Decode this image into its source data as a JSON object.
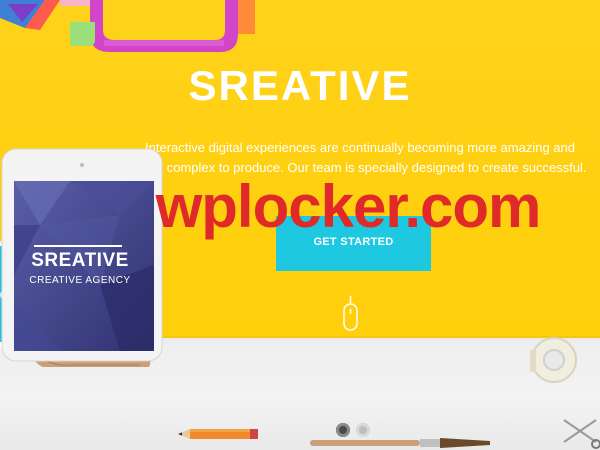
{
  "hero": {
    "title": "SREATIVE",
    "tagline": "Interactive digital experiences are continually becoming more amazing and more complex to produce. Our team is specially designed to create successful.",
    "cta_label": "GET STARTED"
  },
  "tablet": {
    "brand": "SREATIVE",
    "subtitle": "CREATIVE AGENCY"
  },
  "watermark": "wplocker.com",
  "slider": {
    "active_dot": 1,
    "dot_count": 2
  },
  "colors": {
    "background": "#ffd11a",
    "accent": "#1ec8e0",
    "watermark": "#e02a2a"
  }
}
